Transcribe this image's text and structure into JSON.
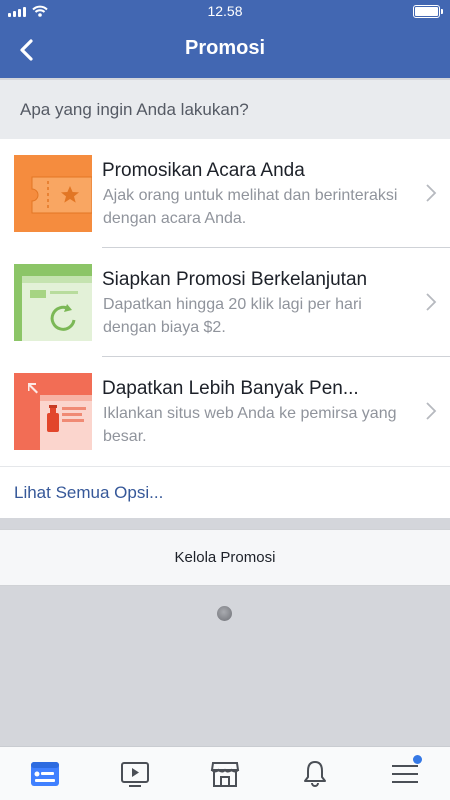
{
  "status_bar": {
    "time": "12.58"
  },
  "header": {
    "title": "Promosi"
  },
  "prompt": "Apa yang ingin Anda lakukan?",
  "options": [
    {
      "title": "Promosikan Acara Anda",
      "description": "Ajak orang untuk melihat dan berinteraksi dengan acara Anda."
    },
    {
      "title": "Siapkan Promosi Berkelanjutan",
      "description": "Dapatkan hingga 20 klik lagi per hari dengan biaya $2."
    },
    {
      "title": "Dapatkan Lebih Banyak Pen...",
      "description": "Iklankan situs web Anda ke pemirsa yang besar."
    }
  ],
  "see_all": "Lihat Semua Opsi...",
  "manage_button": "Kelola Promosi",
  "tabs": [
    {
      "icon": "news-feed-icon",
      "active": true
    },
    {
      "icon": "watch-video-icon"
    },
    {
      "icon": "marketplace-icon"
    },
    {
      "icon": "notifications-bell-icon"
    },
    {
      "icon": "menu-icon",
      "badge": true
    }
  ],
  "colors": {
    "brand": "#4267b2",
    "link": "#365899",
    "event_orange": "#f58c3e",
    "promo_green": "#8cc567",
    "web_red": "#f26d55",
    "active_tab": "#4080ff"
  }
}
